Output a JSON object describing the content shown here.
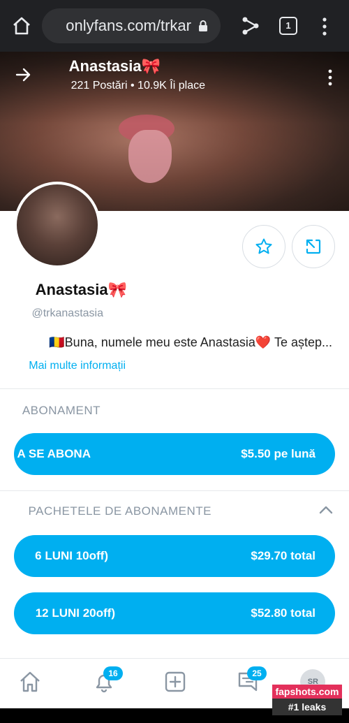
{
  "browser": {
    "url": "onlyfans.com/trkar",
    "tab_count": "1",
    "icons": [
      "home-icon",
      "lock-icon",
      "share-icon",
      "tab-switcher-icon",
      "overflow-menu-icon"
    ]
  },
  "cover": {
    "name": "Anastasia🎀",
    "stats": "221 Postări  •  10.9K Îi place"
  },
  "profile": {
    "name": "Anastasia🎀",
    "handle": "@trkanastasia",
    "bio": "🇷🇴Buna, numele meu este Anastasia❤️ Te aștep...",
    "more_info": "Mai multe informații"
  },
  "subscription": {
    "title": "ABONAMENT",
    "button_label": "A SE ABONA",
    "button_price": "$5.50 pe lună"
  },
  "bundles": {
    "title": "PACHETELE DE ABONAMENTE",
    "items": [
      {
        "label": "6 LUNI 10off)",
        "price": "$29.70 total"
      },
      {
        "label": "12 LUNI 20off)",
        "price": "$52.80 total"
      }
    ]
  },
  "nav": {
    "notifications_badge": "16",
    "messages_badge": "25",
    "avatar_initials": "SR"
  },
  "watermark": {
    "line1": "fapshots.com",
    "line2": "#1 leaks"
  },
  "colors": {
    "accent": "#00aff0",
    "browser_bar": "#202124",
    "muted_text": "#8a96a3"
  }
}
